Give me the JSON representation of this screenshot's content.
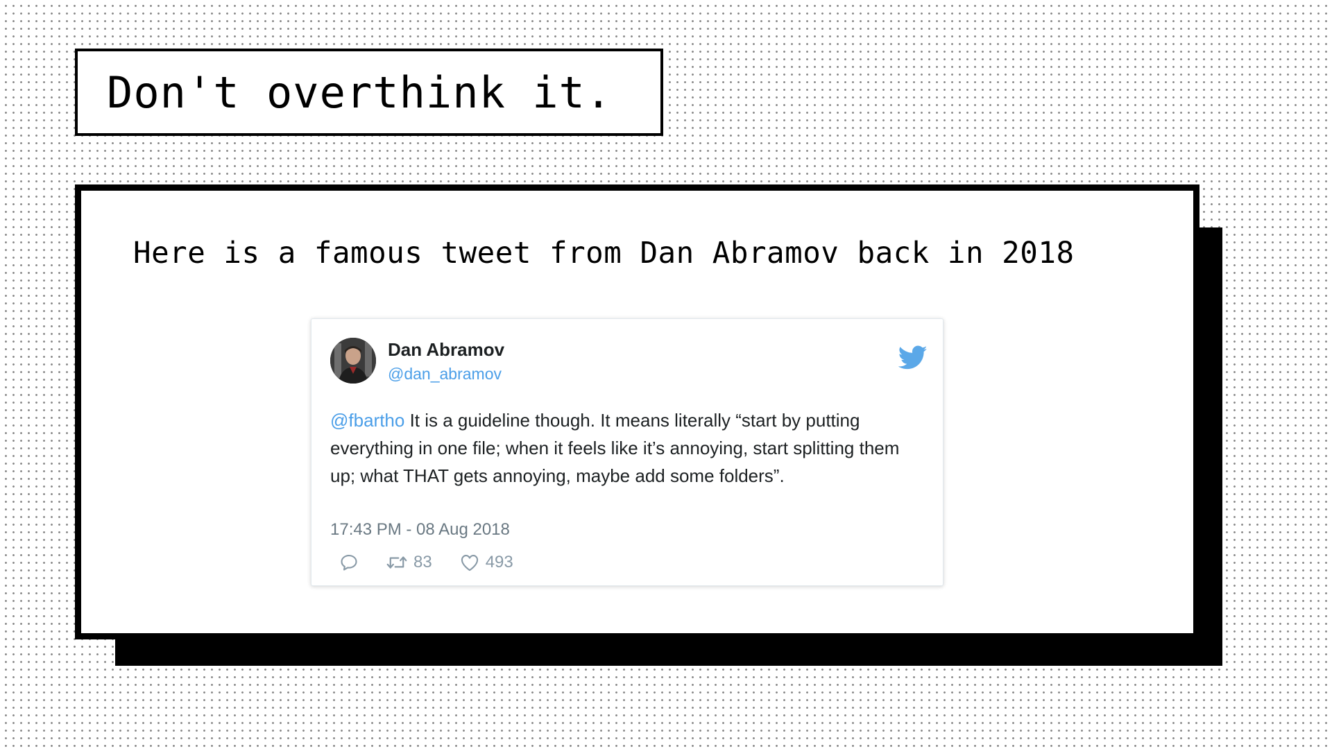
{
  "slide": {
    "title": "Don't overthink it.",
    "heading": "Here is a famous tweet from Dan Abramov back in 2018"
  },
  "tweet": {
    "author_name": "Dan Abramov",
    "author_handle": "@dan_abramov",
    "mention": "@fbartho",
    "text": " It is a guideline though. It means literally “start by putting everything in one file; when it feels like it’s annoying, start splitting them up; what THAT gets annoying, maybe add some folders”.",
    "timestamp": "17:43 PM - 08 Aug 2018",
    "retweets": "83",
    "likes": "493",
    "icons": {
      "reply": "reply-icon",
      "retweet": "retweet-icon",
      "like": "heart-icon",
      "brand": "twitter-bird-icon"
    }
  },
  "colors": {
    "twitter_blue": "#4a9ee8",
    "bird_blue": "#5ba8e8",
    "text_dark": "#1c2022",
    "text_muted": "#697882",
    "action_gray": "#8899a6"
  }
}
